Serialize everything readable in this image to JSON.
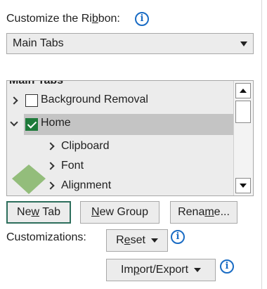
{
  "header": {
    "pre": "Customize the Ri",
    "ul": "b",
    "post": "bon:"
  },
  "combo": {
    "selected": "Main Tabs"
  },
  "tree": {
    "header": "Main Tabs",
    "items": [
      {
        "label": "Background Removal"
      },
      {
        "label": "Home"
      },
      {
        "label": "Clipboard"
      },
      {
        "label": "Font"
      },
      {
        "label": "Alignment"
      }
    ]
  },
  "buttons": {
    "new_tab": {
      "pre": "Ne",
      "ul": "w",
      "post": " Tab"
    },
    "new_group": {
      "pre": "",
      "ul": "N",
      "post": "ew Group"
    },
    "rename": {
      "pre": "Rena",
      "ul": "m",
      "post": "e..."
    }
  },
  "customizations": {
    "label": "Customizations:",
    "reset": {
      "pre": "R",
      "ul": "e",
      "post": "set"
    },
    "import_export": {
      "pre": "Im",
      "ul": "p",
      "post": "ort/Export"
    }
  },
  "icons": {
    "info": "i"
  },
  "colors": {
    "accent": "#1a6cc4",
    "check": "#1e7a3a",
    "focus": "#2d6e5c"
  }
}
